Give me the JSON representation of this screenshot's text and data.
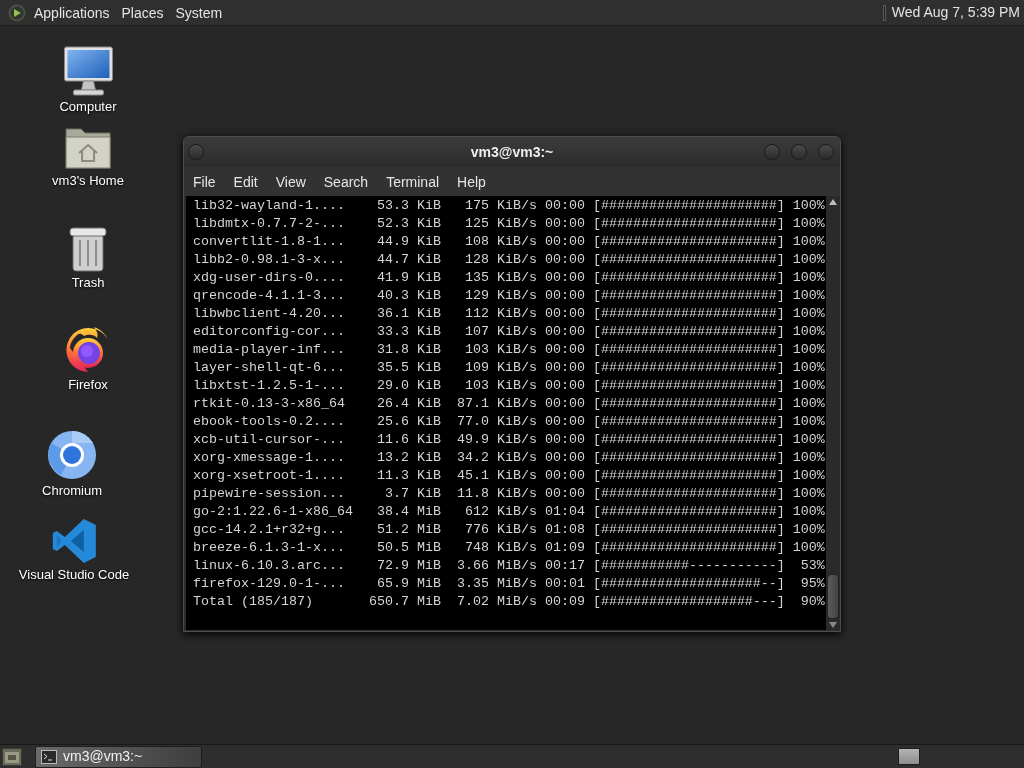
{
  "top_panel": {
    "menus": [
      "Applications",
      "Places",
      "System"
    ],
    "clock": "Wed Aug 7, 5:39 PM"
  },
  "desktop_icons": [
    {
      "kind": "computer",
      "label": "Computer"
    },
    {
      "kind": "home",
      "label": "vm3's Home"
    },
    {
      "kind": "trash",
      "label": "Trash"
    },
    {
      "kind": "firefox",
      "label": "Firefox"
    },
    {
      "kind": "chromium",
      "label": "Chromium"
    },
    {
      "kind": "vscode",
      "label": "Visual Studio Code"
    }
  ],
  "terminal_window": {
    "title": "vm3@vm3:~",
    "menu": [
      "File",
      "Edit",
      "View",
      "Search",
      "Terminal",
      "Help"
    ],
    "lines": [
      "lib32-wayland-1....    53.3 KiB   175 KiB/s 00:00 [######################] 100%",
      "libdmtx-0.7.7-2-...    52.3 KiB   125 KiB/s 00:00 [######################] 100%",
      "convertlit-1.8-1...    44.9 KiB   108 KiB/s 00:00 [######################] 100%",
      "libb2-0.98.1-3-x...    44.7 KiB   128 KiB/s 00:00 [######################] 100%",
      "xdg-user-dirs-0....    41.9 KiB   135 KiB/s 00:00 [######################] 100%",
      "qrencode-4.1.1-3...    40.3 KiB   129 KiB/s 00:00 [######################] 100%",
      "libwbclient-4.20...    36.1 KiB   112 KiB/s 00:00 [######################] 100%",
      "editorconfig-cor...    33.3 KiB   107 KiB/s 00:00 [######################] 100%",
      "media-player-inf...    31.8 KiB   103 KiB/s 00:00 [######################] 100%",
      "layer-shell-qt-6...    35.5 KiB   109 KiB/s 00:00 [######################] 100%",
      "libxtst-1.2.5-1-...    29.0 KiB   103 KiB/s 00:00 [######################] 100%",
      "rtkit-0.13-3-x86_64    26.4 KiB  87.1 KiB/s 00:00 [######################] 100%",
      "ebook-tools-0.2....    25.6 KiB  77.0 KiB/s 00:00 [######################] 100%",
      "xcb-util-cursor-...    11.6 KiB  49.9 KiB/s 00:00 [######################] 100%",
      "xorg-xmessage-1....    13.2 KiB  34.2 KiB/s 00:00 [######################] 100%",
      "xorg-xsetroot-1....    11.3 KiB  45.1 KiB/s 00:00 [######################] 100%",
      "pipewire-session...     3.7 KiB  11.8 KiB/s 00:00 [######################] 100%",
      "go-2:1.22.6-1-x86_64   38.4 MiB   612 KiB/s 01:04 [######################] 100%",
      "gcc-14.2.1+r32+g...    51.2 MiB   776 KiB/s 01:08 [######################] 100%",
      "breeze-6.1.3-1-x...    50.5 MiB   748 KiB/s 01:09 [######################] 100%",
      "linux-6.10.3.arc...    72.9 MiB  3.66 MiB/s 00:17 [###########-----------]  53%",
      "firefox-129.0-1-...    65.9 MiB  3.35 MiB/s 00:01 [####################--]  95%",
      "Total (185/187)       650.7 MiB  7.02 MiB/s 00:09 [###################---]  90%"
    ]
  },
  "taskbar": {
    "tasks": [
      {
        "title": "vm3@vm3:~",
        "selected": true
      }
    ]
  }
}
